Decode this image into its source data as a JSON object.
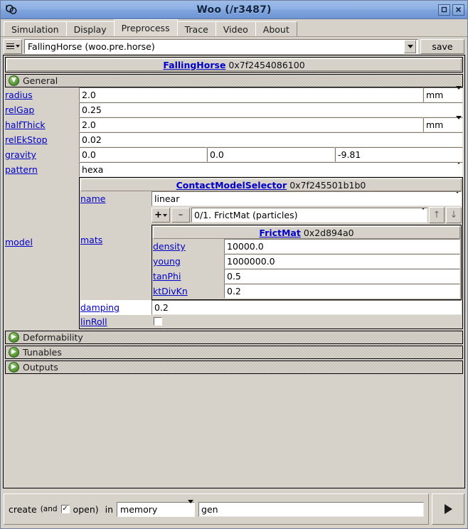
{
  "window": {
    "title": "Woo (/r3487)",
    "icon": "woo-logo-icon",
    "maximize_label": "□",
    "close_label": "✕"
  },
  "tabs": [
    {
      "label": "Simulation",
      "active": false
    },
    {
      "label": "Display",
      "active": false
    },
    {
      "label": "Preprocess",
      "active": true
    },
    {
      "label": "Trace",
      "active": false
    },
    {
      "label": "Video",
      "active": false
    },
    {
      "label": "About",
      "active": false
    }
  ],
  "toolbar": {
    "menu_icon": "hamburger-menu-icon",
    "preprocessor_value": "FallingHorse (woo.pre.horse)",
    "save_label": "save"
  },
  "object_header": {
    "class_name": "FallingHorse",
    "address": "0x7f2454086100"
  },
  "general_group": {
    "label": "General",
    "expanded": true,
    "rows": [
      {
        "label": "radius",
        "value": "2.0",
        "unit": "mm"
      },
      {
        "label": "relGap",
        "value": "0.25"
      },
      {
        "label": "halfThick",
        "value": "2.0",
        "unit": "mm"
      },
      {
        "label": "relEkStop",
        "value": "0.02"
      },
      {
        "label": "gravity",
        "values": [
          "0.0",
          "0.0",
          "-9.81"
        ]
      },
      {
        "label": "pattern",
        "value": "hexa",
        "combo": true
      }
    ]
  },
  "model": {
    "label": "model",
    "contact_model_selector": {
      "class_name": "ContactModelSelector",
      "address": "0x7f245501b1b0"
    },
    "name_row": {
      "label": "name",
      "value": "linear"
    },
    "mats": {
      "label": "mats",
      "add_label": "+",
      "remove_label": "–",
      "selector_value": "0/1. FrictMat  (particles)",
      "up_label": "↑",
      "down_label": "↓",
      "frictmat": {
        "class_name": "FrictMat",
        "address": "0x2d894a0",
        "rows": [
          {
            "label": "density",
            "value": "10000.0"
          },
          {
            "label": "young",
            "value": "1000000.0"
          },
          {
            "label": "tanPhi",
            "value": "0.5"
          },
          {
            "label": "ktDivKn",
            "value": "0.2"
          }
        ]
      }
    },
    "damping": {
      "label": "damping",
      "value": "0.2"
    },
    "linRoll": {
      "label": "linRoll",
      "checked": false
    }
  },
  "collapsed_groups": [
    {
      "label": "Deformability"
    },
    {
      "label": "Tunables"
    },
    {
      "label": "Outputs"
    }
  ],
  "bottom_bar": {
    "create_label": "create",
    "and_label": "(and",
    "open_checked": true,
    "open_label": "open)",
    "in_label": "in",
    "target_value": "memory",
    "name_value": "gen",
    "run_icon": "play-icon"
  }
}
